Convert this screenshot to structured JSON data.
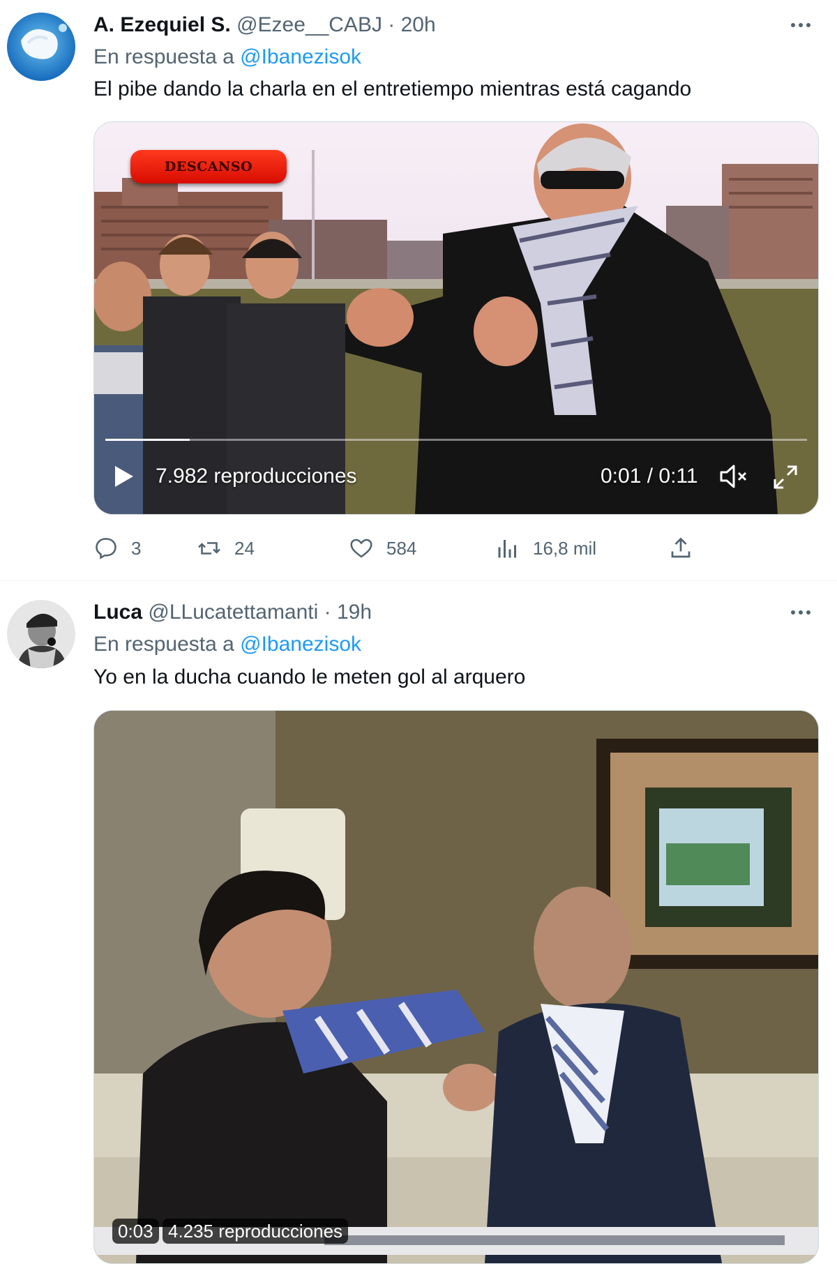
{
  "tweets": [
    {
      "display_name": "A. Ezequiel S.",
      "handle": "@Ezee__CABJ",
      "time": "· 20h",
      "reply_prefix": "En respuesta a",
      "reply_to": "@Ibanezisok",
      "text": "El pibe dando la charla en el entretiempo mientras está cagando",
      "video": {
        "overlay_label": "DESCANSO",
        "views": "7.982 reproducciones",
        "time": "0:01 / 0:11",
        "progress": 0.12
      },
      "actions": {
        "replies": "3",
        "retweets": "24",
        "likes": "584",
        "views": "16,8 mil"
      }
    },
    {
      "display_name": "Luca",
      "handle": "@LLucatettamanti",
      "time": "· 19h",
      "reply_prefix": "En respuesta a",
      "reply_to": "@Ibanezisok",
      "text": "Yo en la ducha cuando le meten gol al arquero",
      "video": {
        "time": "0:03",
        "views": "4.235 reproducciones"
      }
    }
  ],
  "colors": {
    "accent": "#1d9bf0",
    "secondary_text": "#536471",
    "primary_text": "#0f1419",
    "overlay_red": "#e81600"
  }
}
